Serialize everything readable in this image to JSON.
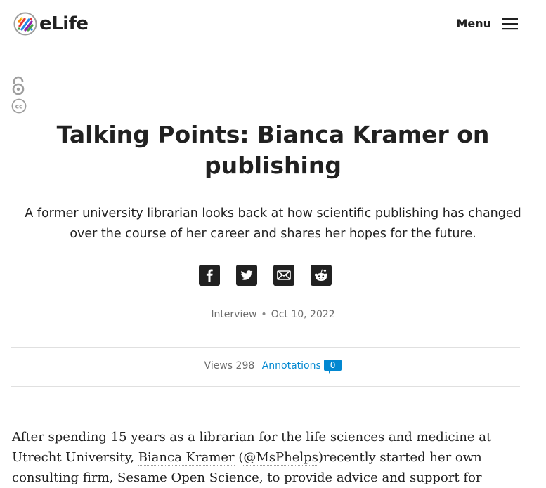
{
  "header": {
    "logo_text": "eLife",
    "menu_label": "Menu",
    "menu_icon": "hamburger-icon"
  },
  "license": {
    "open_access_icon": "open-access-icon",
    "cc_icon": "creative-commons-icon",
    "cc_text": "cc"
  },
  "article": {
    "title": "Talking Points: Bianca Kramer on publishing",
    "impact_statement": "A former university librarian looks back at how scientific publishing has changed over the course of her career and shares her hopes for the future.",
    "type": "Interview",
    "separator": "•",
    "date": "Oct 10, 2022"
  },
  "share": [
    {
      "name": "facebook",
      "icon": "facebook-icon"
    },
    {
      "name": "twitter",
      "icon": "twitter-icon"
    },
    {
      "name": "email",
      "icon": "email-icon"
    },
    {
      "name": "reddit",
      "icon": "reddit-icon"
    }
  ],
  "metrics": {
    "views_label": "Views",
    "views_count": "298",
    "annotations_label": "Annotations",
    "annotations_count": "0"
  },
  "body": {
    "p1_a": "After spending 15 years as a librarian for the life sciences and medicine at Utrecht University, ",
    "p1_link1": "Bianca Kramer",
    "p1_b": " (",
    "p1_link2": "@MsPhelps",
    "p1_c": ")recently started her own consulting firm, Sesame Open Science, to provide advice and support for"
  },
  "colors": {
    "accent": "#0288d1",
    "text": "#212121",
    "muted": "#6d6d6d",
    "rule": "#e0e0e0"
  }
}
